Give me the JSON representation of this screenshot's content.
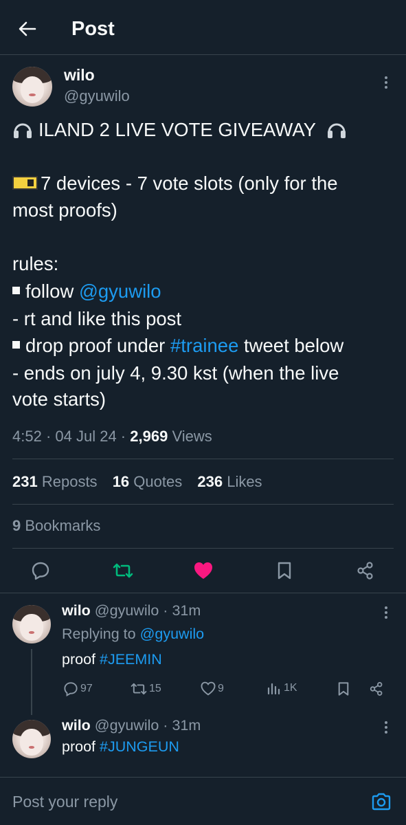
{
  "header": {
    "title": "Post"
  },
  "post": {
    "author_name": "wilo",
    "author_handle": "@gyuwilo",
    "line1": "ILAND 2 LIVE VOTE GIVEAWAY",
    "line2": "7 devices - 7 vote slots (only for the",
    "line3": "most proofs)",
    "rules_label": "rules:",
    "rule1_prefix": "follow",
    "rule1_mention": "@gyuwilo",
    "rule2": "- rt and like this post",
    "rule3_prefix": "drop proof under",
    "rule3_hashtag": "#trainee",
    "rule3_suffix": "tweet below",
    "rule4_line1": "- ends on july 4, 9.30 kst (when the live",
    "rule4_line2": "vote starts)",
    "time": "4:52",
    "date": "04 Jul 24",
    "views_count": "2,969",
    "views_label": "Views",
    "reposts_count": "231",
    "reposts_label": "Reposts",
    "quotes_count": "16",
    "quotes_label": "Quotes",
    "likes_count": "236",
    "likes_label": "Likes",
    "bookmarks_count": "9",
    "bookmarks_label": "Bookmarks"
  },
  "replies": [
    {
      "name": "wilo",
      "handle": "@gyuwilo",
      "time": "31m",
      "replying_label": "Replying to",
      "replying_to": "@gyuwilo",
      "text_prefix": "proof",
      "hashtag": "#JEEMIN",
      "reply_count": "97",
      "repost_count": "15",
      "like_count": "9",
      "view_count": "1K"
    },
    {
      "name": "wilo",
      "handle": "@gyuwilo",
      "time": "31m",
      "text_prefix": "proof",
      "hashtag": "#JUNGEUN"
    }
  ],
  "reply_bar": {
    "placeholder": "Post your reply"
  },
  "colors": {
    "background": "#15202b",
    "link": "#1d9bf0",
    "muted": "#8b98a5",
    "repost_active": "#00ba7c",
    "like_active": "#f91880"
  }
}
